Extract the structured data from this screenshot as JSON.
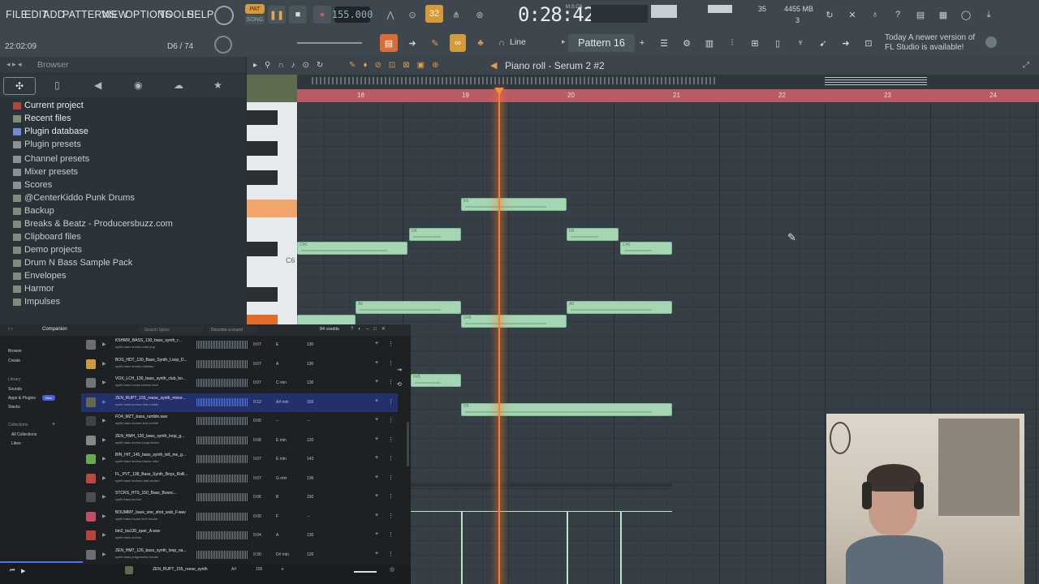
{
  "menu": [
    "FILE",
    "EDIT",
    "ADD",
    "PATTERNS",
    "VIEW",
    "OPTIONS",
    "TOOLS",
    "HELP"
  ],
  "transport": {
    "pat_label": "PAT",
    "song_label": "SONG",
    "tempo": "155.000",
    "time": "0:28:42",
    "time_sub": "M:S:CS",
    "snap_label": "Line",
    "record_hint": "32"
  },
  "status": {
    "hint_time": "22:02:09",
    "pattern_pos": "D6 / 74",
    "cpu": "35",
    "ram": "4455 MB",
    "poly": "3"
  },
  "pattern": {
    "name": "Pattern 16"
  },
  "news": {
    "line1": "Today",
    "line2": "A newer version of",
    "line3": "FL Studio is available!"
  },
  "browser": {
    "title": "Browser",
    "items": [
      {
        "label": "Current project",
        "icon": "project-icon"
      },
      {
        "label": "Recent files",
        "icon": "folder-icon"
      },
      {
        "label": "Plugin database",
        "icon": "plugin-icon"
      },
      {
        "label": "Plugin presets",
        "icon": "preset-icon"
      },
      {
        "label": "Channel presets",
        "icon": "preset-icon"
      },
      {
        "label": "Mixer presets",
        "icon": "preset-icon"
      },
      {
        "label": "Scores",
        "icon": "score-icon"
      },
      {
        "label": "@CenterKiddo Punk Drums",
        "icon": "folder-icon"
      },
      {
        "label": "Backup",
        "icon": "folder-icon"
      },
      {
        "label": "Breaks & Beatz - Producersbuzz.com",
        "icon": "folder-icon"
      },
      {
        "label": "Clipboard files",
        "icon": "folder-icon"
      },
      {
        "label": "Demo projects",
        "icon": "folder-icon"
      },
      {
        "label": "Drum N Bass Sample Pack",
        "icon": "folder-icon"
      },
      {
        "label": "Envelopes",
        "icon": "folder-icon"
      },
      {
        "label": "Harmor",
        "icon": "folder-icon"
      },
      {
        "label": "Impulses",
        "icon": "folder-icon"
      }
    ]
  },
  "piano_roll": {
    "title": "Piano roll - Serum 2 #2",
    "bars": [
      "18",
      "19",
      "20",
      "21",
      "22",
      "23",
      "24"
    ],
    "key_label": "C6",
    "notes": [
      {
        "label": "E6"
      },
      {
        "label": "D6"
      },
      {
        "label": "D6"
      },
      {
        "label": "C#6"
      },
      {
        "label": "C#6"
      },
      {
        "label": "A5"
      },
      {
        "label": "A5"
      },
      {
        "label": "G#5"
      },
      {
        "label": "F#5"
      },
      {
        "label": "D5"
      }
    ]
  },
  "companion": {
    "tab": "Companion",
    "search_placeholder": "Search Splice",
    "describe": "Describe a sound",
    "credits": "84 credits",
    "nav": [
      "Browse",
      "Create"
    ],
    "library_label": "Library",
    "library": [
      "Sounds",
      "Apps & Plugins",
      "Stacks"
    ],
    "new_badge": "New",
    "collections_label": "Collections",
    "collections": [
      "All Collections",
      "Likes"
    ],
    "rows": [
      {
        "title": "KSHMR_BASS_130_bass_synth_r...",
        "tags": "synth  bass  techno  edm  pop",
        "dur": "0:07",
        "key": "E",
        "bpm": "130"
      },
      {
        "title": "BOS_HDT_130_Bass_Synth_Loop_D...",
        "tags": "synth  bass  techno  dubstep",
        "dur": "0:07",
        "key": "A",
        "bpm": "130"
      },
      {
        "title": "VOX_LCH_130_bass_synth_club_bo...",
        "tags": "synth  bass  house  techno  tech",
        "dur": "0:07",
        "key": "C min",
        "bpm": "130"
      },
      {
        "title": "ZEN_RUPT_155_reese_synth_minor...",
        "tags": "synth  bass  techno  dnb  rumble",
        "dur": "0:12",
        "key": "A# min",
        "bpm": "155"
      },
      {
        "title": "FO4_MZT_bass_rumble.wav",
        "tags": "synth  bass  techno  sub  rumble",
        "dur": "0:00",
        "key": "--",
        "bpm": "--"
      },
      {
        "title": "ZEN_HMH_120_bass_synth_loop_g...",
        "tags": "synth  bass  techno  progressive",
        "dur": "0:08",
        "key": "E min",
        "bpm": "120"
      },
      {
        "title": "BIN_HIT_145_bass_synth_tell_me_g...",
        "tags": "synth  bass  techno  trance  edm",
        "dur": "0:07",
        "key": "E min",
        "bpm": "143"
      },
      {
        "title": "FL_PVT_138_Bass_Synth_Boys_Rolli...",
        "tags": "synth  bass  techno  hard techno",
        "dur": "0:07",
        "key": "G min",
        "bpm": "136"
      },
      {
        "title": "STCRS_HTS_150_Bass_Bounc...",
        "tags": "synth  bass  techno",
        "dur": "0:06",
        "key": "B",
        "bpm": "150"
      },
      {
        "title": "BOUMMY_bass_one_shot_wub_F.wav",
        "tags": "synth  bass  house  tech house",
        "dur": "0:00",
        "key": "F",
        "bpm": "--"
      },
      {
        "title": "bin2_ba130_quer_A.wav",
        "tags": "synth  bass  techno",
        "dur": "0:04",
        "key": "A",
        "bpm": "130"
      },
      {
        "title": "ZEN_HMT_126_bass_synth_loop_na...",
        "tags": "synth  bass  progressive house",
        "dur": "0:30",
        "key": "D# min",
        "bpm": "126"
      }
    ],
    "now_playing": "ZEN_RUPT_155_reese_synth",
    "now_key": "A#",
    "now_bpm": "155"
  }
}
